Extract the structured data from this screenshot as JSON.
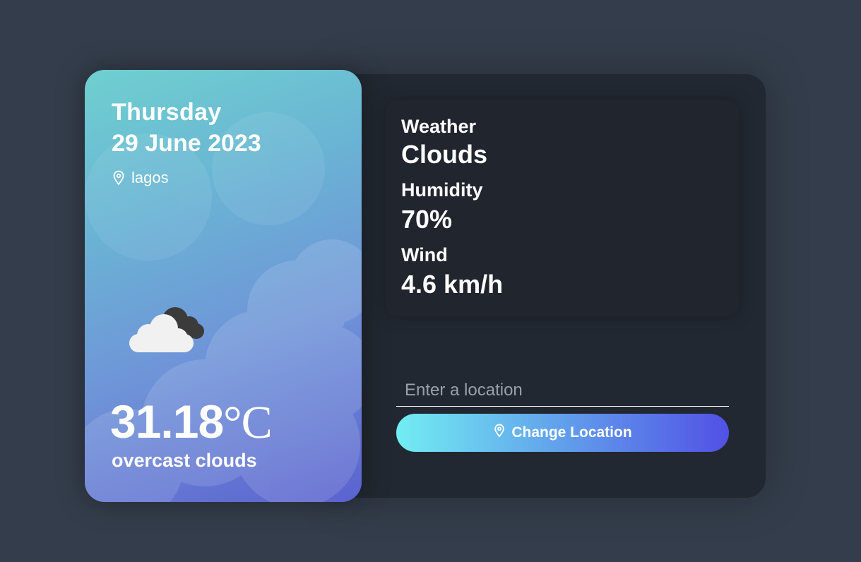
{
  "weather_card": {
    "day": "Thursday",
    "date": "29 June 2023",
    "location": "lagos",
    "temperature": "31.18",
    "temperature_unit": "°C",
    "description": "overcast clouds",
    "icon": "cloud-icon"
  },
  "details": {
    "weather_label": "Weather",
    "weather_value": "Clouds",
    "humidity_label": "Humidity",
    "humidity_value": "70%",
    "wind_label": "Wind",
    "wind_value": "4.6 km/h"
  },
  "search": {
    "placeholder": "Enter a location",
    "value": ""
  },
  "button": {
    "label": "Change Location",
    "icon": "location-pin-icon"
  },
  "colors": {
    "page_background": "#343d4b",
    "card_background": "#222831",
    "gradient_start": "#72edf2",
    "gradient_end": "#5151e5"
  }
}
